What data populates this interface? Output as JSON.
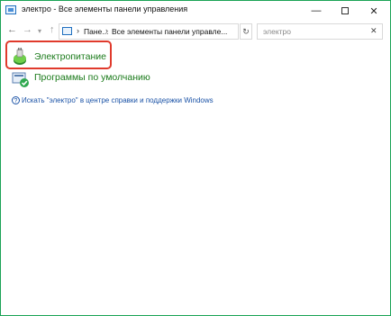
{
  "window": {
    "title": "электро - Все элементы панели управления",
    "controls": {
      "minimize": "—",
      "close": "✕"
    }
  },
  "address": {
    "crumbs": [
      "Пане...",
      "Все элементы панели управле..."
    ],
    "search_value": "электро",
    "search_clear": "✕"
  },
  "nav": {
    "back": "←",
    "forward": "→",
    "recent": "▾",
    "up": "↑",
    "refresh": "↻"
  },
  "results": [
    {
      "label": "Электропитание"
    },
    {
      "label": "Программы по умолчанию"
    }
  ],
  "help": {
    "icon": "?",
    "text": "Искать \"электро\" в центре справки и поддержки Windows"
  },
  "colors": {
    "accent_border": "#1ba356",
    "item_text": "#1a7a1a",
    "link": "#1a52a6",
    "highlight": "#e03a2c"
  }
}
